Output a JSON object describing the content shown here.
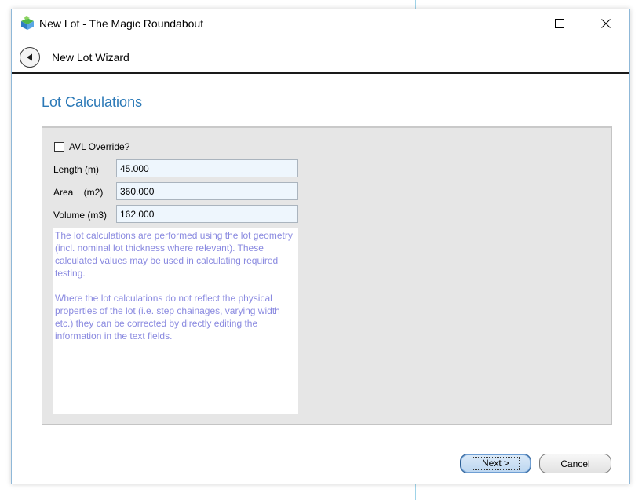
{
  "window": {
    "title": "New Lot - The Magic Roundabout",
    "icon": "app-cube-icon",
    "controls": [
      "minimize-icon",
      "maximize-icon",
      "close-icon"
    ]
  },
  "wizard": {
    "back_icon": "back-arrow-icon",
    "title": "New Lot Wizard"
  },
  "page": {
    "heading": "Lot Calculations",
    "heading_color": "#2b79b7"
  },
  "form": {
    "avl_override": {
      "label": "AVL Override?",
      "checked": false
    },
    "length": {
      "label": "Length (m)",
      "value": "45.000"
    },
    "area": {
      "label": "Area    (m2)",
      "value": "360.000"
    },
    "volume": {
      "label": "Volume (m3)",
      "value": "162.000"
    }
  },
  "info": {
    "text_color": "#8a8ae0",
    "paragraph1": "The lot calculations are performed using the lot geometry (incl. nominal lot thickness where relevant). These calculated values may be used in calculating required testing.",
    "paragraph2": "Where the lot calculations do not reflect the physical properties of the lot (i.e. step chainages, varying width etc.) they can be corrected by directly editing the information in the text fields."
  },
  "buttons": {
    "next_label": "Next >",
    "cancel_label": "Cancel"
  }
}
